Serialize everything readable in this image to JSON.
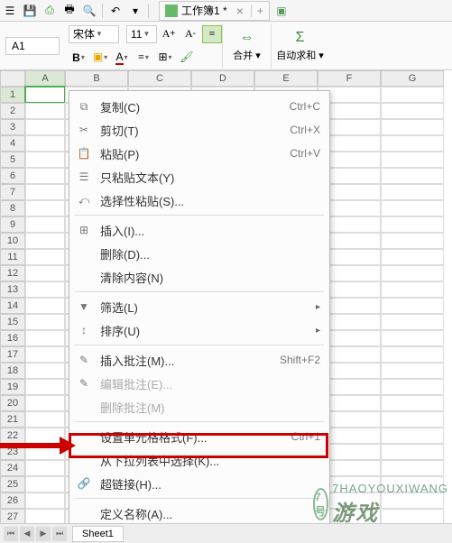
{
  "toolbar": {
    "cell_reference": "A1",
    "font_name": "宋体",
    "font_size": "11",
    "merge_label": "合并 ▾",
    "autosum_label": "自动求和 ▾"
  },
  "tab": {
    "title": "工作簿1 *"
  },
  "columns": [
    "A",
    "B",
    "C",
    "D",
    "E",
    "F",
    "G"
  ],
  "row_count": 27,
  "sheet_tabs": {
    "active": "Sheet1"
  },
  "ctx": {
    "items": [
      {
        "icon": "⧉",
        "label": "复制(C)",
        "shortcut": "Ctrl+C"
      },
      {
        "icon": "✂",
        "label": "剪切(T)",
        "shortcut": "Ctrl+X"
      },
      {
        "icon": "📋",
        "label": "粘贴(P)",
        "shortcut": "Ctrl+V"
      },
      {
        "icon": "☰",
        "label": "只粘贴文本(Y)",
        "shortcut": ""
      },
      {
        "icon": "⤺",
        "label": "选择性粘贴(S)...",
        "shortcut": ""
      },
      {
        "sep": true
      },
      {
        "icon": "⊞",
        "label": "插入(I)...",
        "shortcut": ""
      },
      {
        "icon": "",
        "label": "删除(D)...",
        "shortcut": ""
      },
      {
        "icon": "",
        "label": "清除内容(N)",
        "shortcut": ""
      },
      {
        "sep": true
      },
      {
        "icon": "▼",
        "label": "筛选(L)",
        "shortcut": "",
        "submenu": true
      },
      {
        "icon": "↕",
        "label": "排序(U)",
        "shortcut": "",
        "submenu": true
      },
      {
        "sep": true
      },
      {
        "icon": "✎",
        "label": "插入批注(M)...",
        "shortcut": "Shift+F2"
      },
      {
        "icon": "✎",
        "label": "编辑批注(E)...",
        "shortcut": "",
        "disabled": true
      },
      {
        "icon": "",
        "label": "删除批注(M)",
        "shortcut": "",
        "disabled": true
      },
      {
        "sep": true
      },
      {
        "icon": "",
        "label": "设置单元格格式(F)...",
        "shortcut": "Ctrl+1"
      },
      {
        "icon": "",
        "label": "从下拉列表中选择(K)...",
        "shortcut": ""
      },
      {
        "icon": "🔗",
        "label": "超链接(H)...",
        "shortcut": ""
      },
      {
        "sep": true
      },
      {
        "icon": "",
        "label": "定义名称(A)...",
        "shortcut": ""
      }
    ]
  },
  "watermark": {
    "brand": "7号",
    "sub": "7HAOYOUXIWANG",
    "cn": "游戏"
  }
}
